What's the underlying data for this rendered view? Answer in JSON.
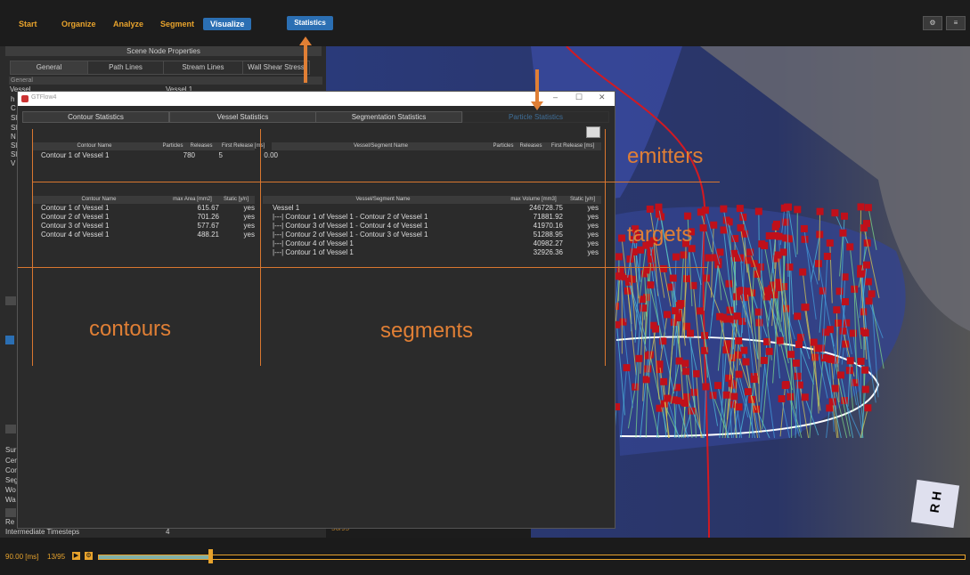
{
  "menu": {
    "items": [
      "Start",
      "Organize",
      "Analyze",
      "Segment",
      "Visualize"
    ],
    "active": "Visualize",
    "statistics_label": "Statistics"
  },
  "left_panel": {
    "title": "Scene Node Properties",
    "tabs": [
      "General",
      "Path Lines",
      "Stream Lines",
      "Wall Shear Stress"
    ],
    "section": "General",
    "first_label": "Vessel",
    "first_value": "Vessel 1",
    "side_letters": [
      "h",
      "C",
      "Sl",
      "Sl",
      "N",
      "Sl",
      "Sl",
      "V"
    ],
    "lower_labels": [
      "Sur",
      "Cer",
      "Cor",
      "Seg",
      "Wo",
      "Wa",
      "Re"
    ],
    "bottom_label": "Intermediate Timesteps",
    "bottom_value": "4"
  },
  "gtflow": {
    "title": "GTFlow4",
    "tabs": [
      "Contour Statistics",
      "Vessel Statistics",
      "Segmentation Statistics",
      "Particle Statistics"
    ],
    "emitter_table": {
      "headers": [
        "Contour Name",
        "Particles",
        "Releases",
        "First Release [ms]"
      ],
      "rows": [
        [
          "Contour 1 of Vessel 1",
          "780",
          "5",
          "0.00"
        ]
      ]
    },
    "segment_emitter_table": {
      "headers": [
        "Vessel/Segment Name",
        "Particles",
        "Releases",
        "First Release [ms]"
      ]
    },
    "contour_table": {
      "headers": [
        "Contour Name",
        "max Area [mm2]",
        "Static [y/n]"
      ],
      "rows": [
        [
          "Contour 1 of Vessel 1",
          "615.67",
          "yes"
        ],
        [
          "Contour 2 of Vessel 1",
          "701.26",
          "yes"
        ],
        [
          "Contour 3 of Vessel 1",
          "577.67",
          "yes"
        ],
        [
          "Contour 4 of Vessel 1",
          "488.21",
          "yes"
        ]
      ]
    },
    "segment_table": {
      "headers": [
        "Vessel/Segment Name",
        "max Volume [mm3]",
        "Static [y/n]"
      ],
      "rows": [
        [
          "Vessel 1",
          "246728.75",
          "yes"
        ],
        [
          "|---| Contour 1 of Vessel 1 - Contour 2 of Vessel 1",
          "71881.92",
          "yes"
        ],
        [
          "|---| Contour 3 of Vessel 1 - Contour 4 of Vessel 1",
          "41970.16",
          "yes"
        ],
        [
          "|---| Contour 2 of Vessel 1 - Contour 3 of Vessel 1",
          "51288.95",
          "yes"
        ],
        [
          "|---| Contour 4 of Vessel 1",
          "40982.27",
          "yes"
        ],
        [
          "|---| Contour 1 of Vessel 1",
          "32926.36",
          "yes"
        ]
      ]
    }
  },
  "annotations": {
    "emitters": "emitters",
    "targets": "targets",
    "contours": "contours",
    "segments": "segments"
  },
  "viewport": {
    "orientation_cube": "R H",
    "frame_label": "56/95"
  },
  "timeline": {
    "time": "90.00 [ms]",
    "frame": "13/95",
    "progress": 0.13
  },
  "colors": {
    "accent_orange": "#e07f35",
    "menu_yellow": "#e8a32c",
    "active_blue": "#2b6fb3",
    "particle_red": "#c0101a"
  }
}
